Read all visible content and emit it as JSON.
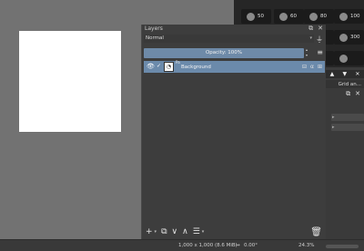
{
  "brush_presets": [
    {
      "size": "50"
    },
    {
      "size": "60"
    },
    {
      "size": "80"
    },
    {
      "size": "100"
    },
    {
      "size": ""
    },
    {
      "size": ""
    },
    {
      "size": ""
    },
    {
      "size": "300"
    },
    {
      "size": ""
    },
    {
      "size": ""
    },
    {
      "size": ""
    },
    {
      "size": ""
    }
  ],
  "right_dock": {
    "tab_label": "Grid an..."
  },
  "layers_panel": {
    "title": "Layers",
    "blend_mode": "Normal",
    "opacity_label": "Opacity:  100%",
    "layer": {
      "name": "Background",
      "sublabel": "Pa"
    }
  },
  "statusbar": {
    "image_size": "1,000 x 1,000 (8.6 MiB)",
    "rotation": "0.00°",
    "zoom": "24.3%"
  }
}
